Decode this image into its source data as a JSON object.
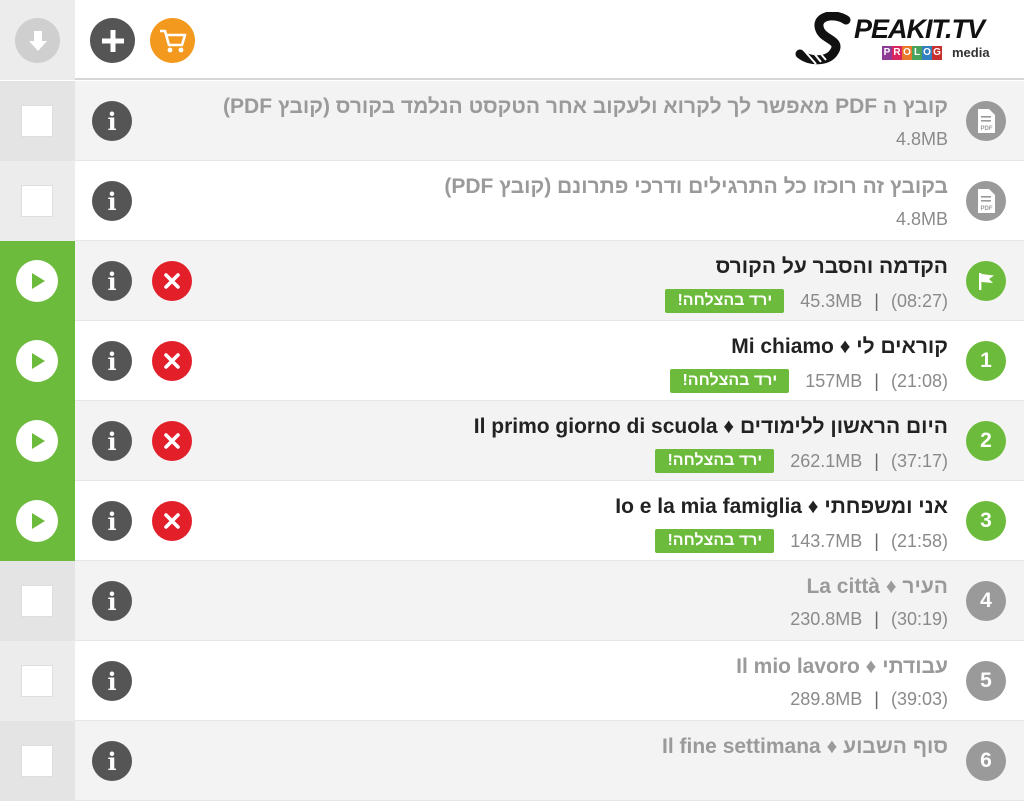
{
  "header": {
    "logo_text": "PEAKIT.TV",
    "logo_sub_letters": [
      "P",
      "R",
      "O",
      "L",
      "O",
      "G"
    ],
    "logo_sub_colors": [
      "#8e3b96",
      "#d9245f",
      "#e8792a",
      "#4aa35a",
      "#2f7fc1",
      "#c7302d"
    ],
    "logo_media": "media",
    "buttons": [
      {
        "name": "download-button",
        "icon": "download-icon",
        "color": "#cfcfcf"
      },
      {
        "name": "add-button",
        "icon": "plus-icon",
        "color": "#555555"
      },
      {
        "name": "cart-button",
        "icon": "cart-icon",
        "color": "#f39a1e"
      }
    ]
  },
  "status_label": "ירד בהצלחה!",
  "rows": [
    {
      "kind": "pdf",
      "title": "קובץ ה PDF מאפשר לך לקרוא ולעקוב אחר הטקסט הנלמד בקורס (קובץ PDF)",
      "size": "4.8MB",
      "duration": "",
      "downloaded": false
    },
    {
      "kind": "pdf",
      "title": "בקובץ זה רוכזו כל התרגילים ודרכי פתרונם (קובץ PDF)",
      "size": "4.8MB",
      "duration": "",
      "downloaded": false
    },
    {
      "kind": "flag",
      "title": "הקדמה והסבר על הקורס",
      "size": "45.3MB",
      "duration": "(08:27)",
      "downloaded": true
    },
    {
      "kind": "num",
      "num": "1",
      "title": "קוראים לי ♦ Mi chiamo",
      "size": "157MB",
      "duration": "(21:08)",
      "downloaded": true
    },
    {
      "kind": "num",
      "num": "2",
      "title": "היום הראשון ללימודים ♦ Il primo giorno di scuola",
      "size": "262.1MB",
      "duration": "(37:17)",
      "downloaded": true
    },
    {
      "kind": "num",
      "num": "3",
      "title": "אני ומשפחתי ♦ Io e la mia famiglia",
      "size": "143.7MB",
      "duration": "(21:58)",
      "downloaded": true
    },
    {
      "kind": "num",
      "num": "4",
      "title": "העיר ♦ La città",
      "size": "230.8MB",
      "duration": "(30:19)",
      "downloaded": false
    },
    {
      "kind": "num",
      "num": "5",
      "title": "עבודתי ♦ Il mio lavoro",
      "size": "289.8MB",
      "duration": "(39:03)",
      "downloaded": false
    },
    {
      "kind": "num",
      "num": "6",
      "title": "סוף השבוע ♦ Il fine settimana",
      "size": "",
      "duration": "",
      "downloaded": false
    }
  ],
  "colors": {
    "accent_green": "#6cbb3c",
    "delete_red": "#e3202a",
    "info_dark": "#555555",
    "cart_orange": "#f39a1e"
  }
}
